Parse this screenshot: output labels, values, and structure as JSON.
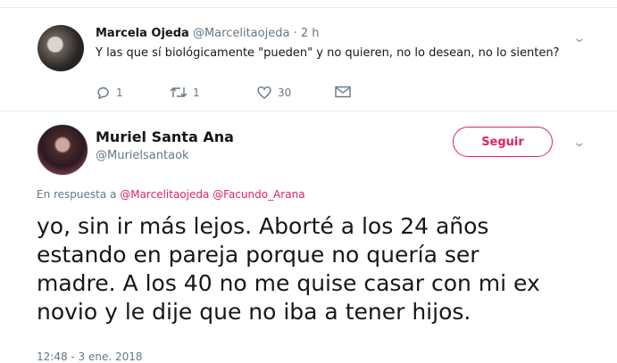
{
  "reply_tweet": {
    "name": "Marcela Ojeda",
    "handle": "@Marcelitaojeda",
    "separator": "·",
    "time": "2 h",
    "text": "Y las que sí biológicamente \"pueden\" y no quieren, no lo desean, no lo sienten?",
    "replies": "1",
    "retweets": "1",
    "likes": "30"
  },
  "main_tweet": {
    "name": "Muriel Santa Ana",
    "handle": "@Murielsantaok",
    "follow_label": "Seguir",
    "replying_prefix": "En respuesta a",
    "mention_1": "@Marcelitaojeda",
    "mention_2": "@Facundo_Arana",
    "body_lines": [
      "yo, sin ir más lejos. Aborté a los 24 años",
      "estando en pareja porque no quería ser",
      "madre. A los 40 no me quise casar con mi ex",
      "novio y le dije que no iba a tener hijos."
    ],
    "timestamp": "12:48 - 3 ene. 2018"
  },
  "colors": {
    "accent": "#e0245e",
    "secondary_text": "#657786",
    "primary_text": "#14171a",
    "divider": "#e6ecf0"
  },
  "icons": [
    "reply-icon",
    "retweet-icon",
    "like-icon",
    "message-icon",
    "chevron-down-icon"
  ]
}
